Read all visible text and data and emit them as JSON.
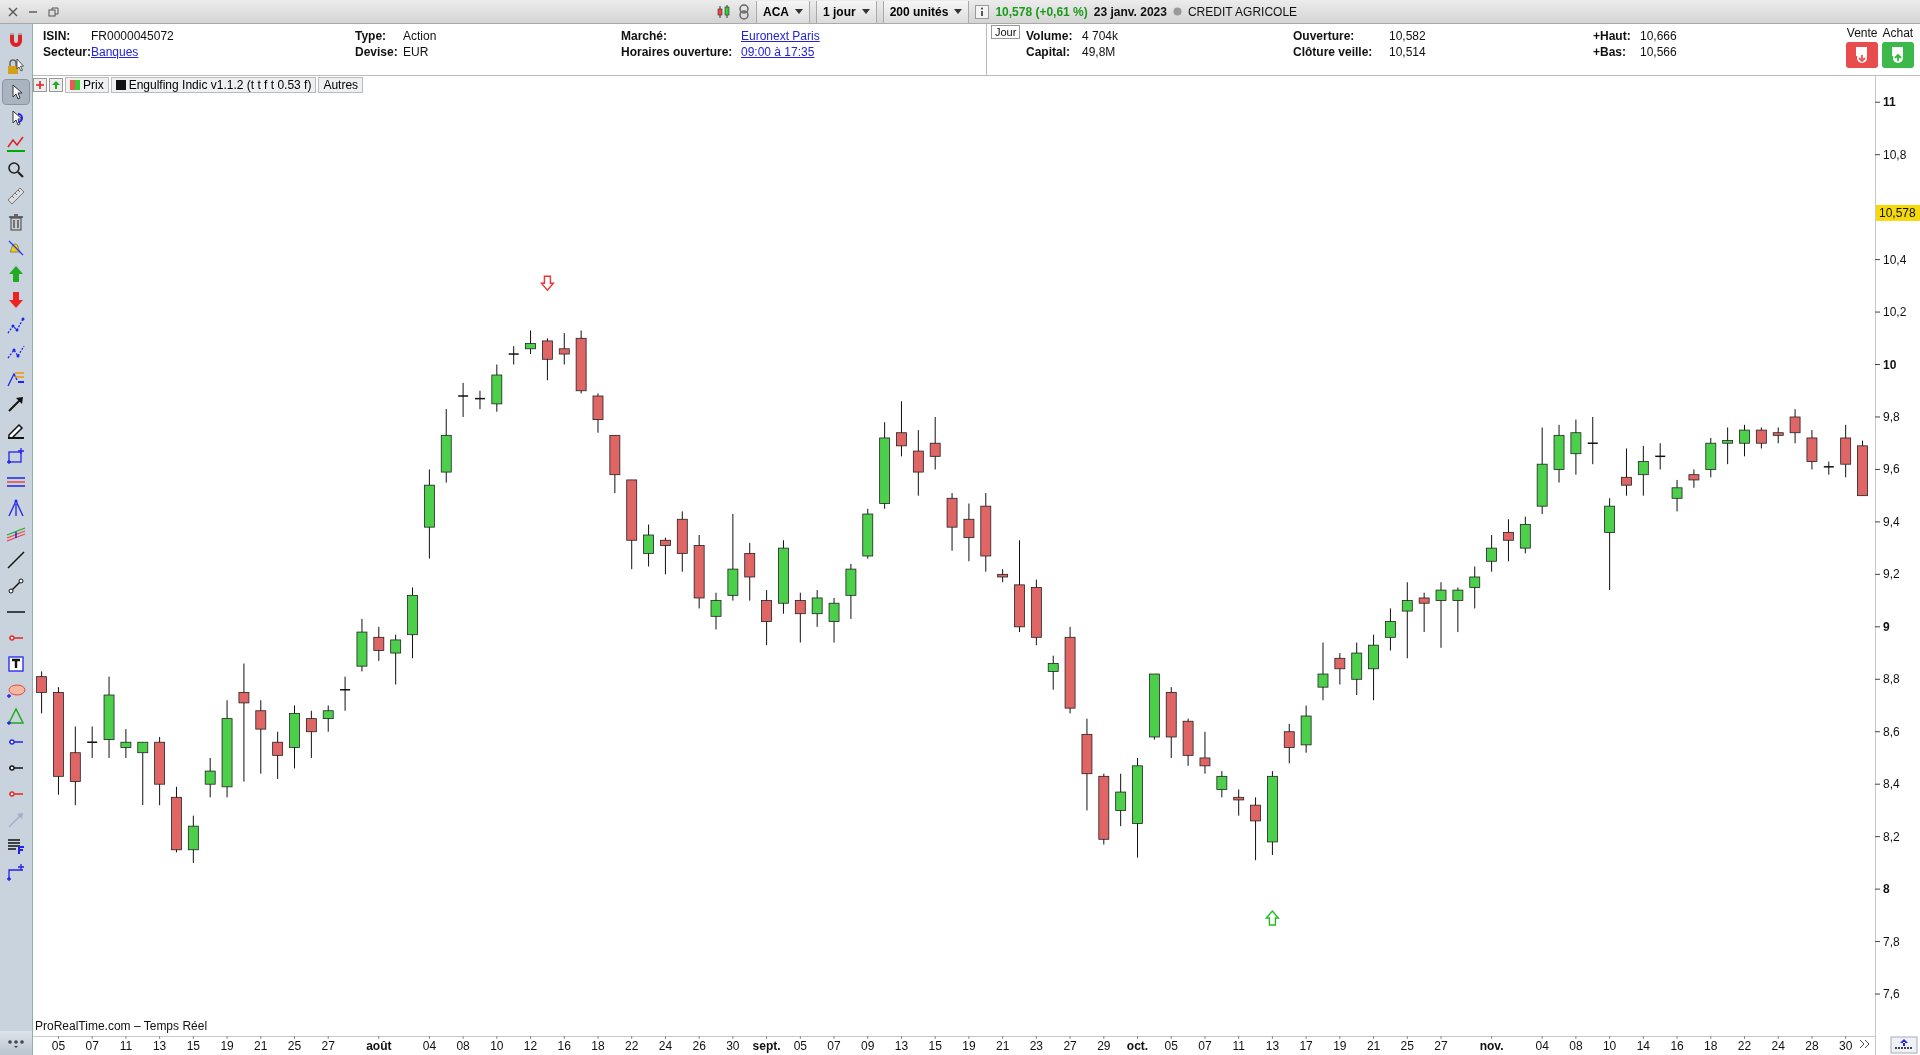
{
  "toolbar": {
    "symbol": "ACA",
    "period": "1 jour",
    "units": "200 unités",
    "quote": "10,578 (+0,61 %)",
    "date": "23 janv. 2023",
    "name": "CREDIT AGRICOLE"
  },
  "info": {
    "left": [
      {
        "label": "ISIN:",
        "value": "FR0000045072",
        "kind": "text"
      },
      {
        "label": "Type:",
        "value": "Action",
        "kind": "text"
      },
      {
        "label": "Marché:",
        "value": "Euronext Paris",
        "kind": "link"
      },
      {
        "label": "Secteur:",
        "value": "Banques",
        "kind": "link"
      },
      {
        "label": "Devise:",
        "value": "EUR",
        "kind": "text"
      },
      {
        "label": "Horaires ouverture:",
        "value": "09:00 à 17:35",
        "kind": "link"
      }
    ],
    "period_tab": "Jour",
    "right": [
      {
        "label": "Volume:",
        "value": "4 704k"
      },
      {
        "label": "Ouverture:",
        "value": "10,582"
      },
      {
        "label": "+Haut:",
        "value": "10,666"
      },
      {
        "label": "Capital:",
        "value": "49,8M"
      },
      {
        "label": "Clôture veille:",
        "value": "10,514"
      },
      {
        "label": "+Bas:",
        "value": "10,566"
      }
    ],
    "trade": {
      "sell_label": "Vente",
      "buy_label": "Achat"
    }
  },
  "tools": [
    {
      "selected": false
    },
    {
      "selected": false
    },
    {
      "selected": true
    },
    {
      "selected": false
    },
    {
      "selected": false
    },
    {
      "selected": false
    },
    {
      "selected": false
    },
    {
      "selected": false
    },
    {
      "selected": false
    },
    {
      "selected": false
    },
    {
      "selected": false
    },
    {
      "selected": false
    },
    {
      "selected": false
    },
    {
      "selected": false
    },
    {
      "selected": false
    },
    {
      "selected": false
    },
    {
      "selected": false
    },
    {
      "selected": false
    },
    {
      "selected": false
    },
    {
      "selected": false
    },
    {
      "selected": false
    },
    {
      "selected": false
    },
    {
      "selected": false
    },
    {
      "selected": false
    },
    {
      "selected": false
    },
    {
      "selected": false
    },
    {
      "selected": false
    },
    {
      "selected": false
    },
    {
      "selected": false
    },
    {
      "selected": false
    },
    {
      "selected": false
    },
    {
      "selected": false
    },
    {
      "selected": false
    }
  ],
  "legend": [
    {
      "label": "Prix",
      "kind": "price"
    },
    {
      "label": "Engulfing Indic v1.1.2 (t t f t 0.53 f)",
      "kind": "indicator"
    },
    {
      "label": "Autres",
      "kind": "plain"
    }
  ],
  "chart": {
    "source": "ProRealTime.com – Temps Réel",
    "price_tag": "10,578",
    "chart_data": {
      "type": "candlestick",
      "ylim": [
        7.44,
        11.1
      ],
      "categories": [
        null,
        "05",
        null,
        "07",
        null,
        "11",
        null,
        "13",
        null,
        "15",
        null,
        "19",
        null,
        "21",
        null,
        "25",
        null,
        "27",
        null,
        null,
        "août",
        null,
        null,
        "04",
        null,
        "08",
        null,
        "10",
        null,
        "12",
        null,
        "16",
        null,
        "18",
        null,
        "22",
        null,
        "24",
        null,
        "26",
        null,
        "30",
        null,
        "sept.",
        null,
        "05",
        null,
        "07",
        null,
        "09",
        null,
        "13",
        null,
        "15",
        null,
        "19",
        null,
        "21",
        null,
        "23",
        null,
        "27",
        null,
        "29",
        null,
        "oct.",
        null,
        "05",
        null,
        "07",
        null,
        "11",
        null,
        "13",
        null,
        "17",
        null,
        "19",
        null,
        "21",
        null,
        "25",
        null,
        "27",
        null,
        null,
        "nov.",
        null,
        null,
        "04",
        null,
        "08",
        null,
        "10",
        null,
        "14",
        null,
        "16",
        null,
        "18",
        null,
        "22",
        null,
        "24",
        null,
        "28",
        null,
        "30",
        null
      ],
      "ohlc": [
        [
          8.81,
          8.83,
          8.67,
          8.75
        ],
        [
          8.75,
          8.77,
          8.36,
          8.43
        ],
        [
          8.52,
          8.62,
          8.32,
          8.41
        ],
        [
          8.56,
          8.62,
          8.5,
          8.56
        ],
        [
          8.57,
          8.81,
          8.5,
          8.74
        ],
        [
          8.54,
          8.61,
          8.5,
          8.56
        ],
        [
          8.52,
          8.56,
          8.32,
          8.56
        ],
        [
          8.56,
          8.58,
          8.32,
          8.4
        ],
        [
          8.35,
          8.39,
          8.14,
          8.15
        ],
        [
          8.15,
          8.28,
          8.1,
          8.24
        ],
        [
          8.4,
          8.5,
          8.35,
          8.45
        ],
        [
          8.39,
          8.72,
          8.35,
          8.65
        ],
        [
          8.75,
          8.86,
          8.41,
          8.71
        ],
        [
          8.68,
          8.72,
          8.44,
          8.61
        ],
        [
          8.56,
          8.6,
          8.42,
          8.51
        ],
        [
          8.54,
          8.7,
          8.46,
          8.67
        ],
        [
          8.65,
          8.68,
          8.5,
          8.6
        ],
        [
          8.65,
          8.7,
          8.6,
          8.68
        ],
        [
          8.76,
          8.81,
          8.68,
          8.76
        ],
        [
          8.85,
          9.03,
          8.83,
          8.98
        ],
        [
          8.96,
          9.0,
          8.87,
          8.91
        ],
        [
          8.9,
          8.97,
          8.78,
          8.95
        ],
        [
          8.97,
          9.15,
          8.88,
          9.12
        ],
        [
          9.38,
          9.6,
          9.26,
          9.54
        ],
        [
          9.59,
          9.83,
          9.55,
          9.73
        ],
        [
          9.88,
          9.93,
          9.8,
          9.88
        ],
        [
          9.87,
          9.9,
          9.83,
          9.87
        ],
        [
          9.85,
          10.0,
          9.82,
          9.96
        ],
        [
          10.04,
          10.07,
          10.0,
          10.04
        ],
        [
          10.06,
          10.13,
          10.04,
          10.08
        ],
        [
          10.09,
          10.1,
          9.94,
          10.02
        ],
        [
          10.06,
          10.12,
          10.0,
          10.04
        ],
        [
          10.1,
          10.13,
          9.89,
          9.9
        ],
        [
          9.88,
          9.89,
          9.74,
          9.79
        ],
        [
          9.73,
          9.73,
          9.51,
          9.58
        ],
        [
          9.56,
          9.56,
          9.22,
          9.33
        ],
        [
          9.28,
          9.39,
          9.23,
          9.35
        ],
        [
          9.33,
          9.34,
          9.2,
          9.31
        ],
        [
          9.41,
          9.44,
          9.21,
          9.28
        ],
        [
          9.31,
          9.35,
          9.07,
          9.11
        ],
        [
          9.04,
          9.13,
          8.99,
          9.1
        ],
        [
          9.12,
          9.43,
          9.1,
          9.22
        ],
        [
          9.28,
          9.32,
          9.1,
          9.19
        ],
        [
          9.1,
          9.14,
          8.93,
          9.02
        ],
        [
          9.09,
          9.33,
          9.05,
          9.3
        ],
        [
          9.1,
          9.13,
          8.94,
          9.05
        ],
        [
          9.05,
          9.14,
          9.0,
          9.11
        ],
        [
          9.02,
          9.11,
          8.94,
          9.09
        ],
        [
          9.12,
          9.24,
          9.03,
          9.22
        ],
        [
          9.27,
          9.45,
          9.26,
          9.43
        ],
        [
          9.47,
          9.78,
          9.45,
          9.72
        ],
        [
          9.74,
          9.86,
          9.65,
          9.69
        ],
        [
          9.67,
          9.75,
          9.5,
          9.59
        ],
        [
          9.7,
          9.8,
          9.6,
          9.65
        ],
        [
          9.49,
          9.51,
          9.29,
          9.38
        ],
        [
          9.41,
          9.47,
          9.25,
          9.34
        ],
        [
          9.46,
          9.51,
          9.21,
          9.27
        ],
        [
          9.2,
          9.22,
          9.17,
          9.19
        ],
        [
          9.16,
          9.33,
          8.98,
          9.0
        ],
        [
          9.15,
          9.18,
          8.93,
          8.96
        ],
        [
          8.83,
          8.89,
          8.76,
          8.86
        ],
        [
          8.96,
          9.0,
          8.67,
          8.69
        ],
        [
          8.59,
          8.65,
          8.3,
          8.44
        ],
        [
          8.43,
          8.44,
          8.17,
          8.19
        ],
        [
          8.3,
          8.44,
          8.24,
          8.37
        ],
        [
          8.25,
          8.5,
          8.12,
          8.47
        ],
        [
          8.58,
          8.82,
          8.57,
          8.82
        ],
        [
          8.75,
          8.77,
          8.5,
          8.58
        ],
        [
          8.64,
          8.65,
          8.47,
          8.51
        ],
        [
          8.5,
          8.6,
          8.44,
          8.47
        ],
        [
          8.38,
          8.45,
          8.35,
          8.43
        ],
        [
          8.35,
          8.38,
          8.28,
          8.34
        ],
        [
          8.32,
          8.35,
          8.11,
          8.26
        ],
        [
          8.18,
          8.45,
          8.13,
          8.43
        ],
        [
          8.6,
          8.63,
          8.48,
          8.54
        ],
        [
          8.55,
          8.7,
          8.52,
          8.66
        ],
        [
          8.77,
          8.94,
          8.72,
          8.82
        ],
        [
          8.88,
          8.9,
          8.78,
          8.84
        ],
        [
          8.8,
          8.94,
          8.74,
          8.9
        ],
        [
          8.84,
          8.97,
          8.72,
          8.93
        ],
        [
          8.96,
          9.07,
          8.91,
          9.02
        ],
        [
          9.06,
          9.17,
          8.88,
          9.1
        ],
        [
          9.11,
          9.13,
          8.98,
          9.09
        ],
        [
          9.1,
          9.17,
          8.92,
          9.14
        ],
        [
          9.1,
          9.15,
          8.98,
          9.14
        ],
        [
          9.15,
          9.23,
          9.07,
          9.19
        ],
        [
          9.25,
          9.35,
          9.21,
          9.3
        ],
        [
          9.36,
          9.41,
          9.25,
          9.33
        ],
        [
          9.3,
          9.42,
          9.28,
          9.39
        ],
        [
          9.46,
          9.76,
          9.43,
          9.62
        ],
        [
          9.6,
          9.77,
          9.55,
          9.73
        ],
        [
          9.66,
          9.79,
          9.58,
          9.74
        ],
        [
          9.7,
          9.8,
          9.62,
          9.7
        ],
        [
          9.36,
          9.49,
          9.14,
          9.46
        ],
        [
          9.57,
          9.68,
          9.5,
          9.54
        ],
        [
          9.58,
          9.69,
          9.5,
          9.63
        ],
        [
          9.65,
          9.7,
          9.6,
          9.65
        ],
        [
          9.49,
          9.56,
          9.44,
          9.53
        ],
        [
          9.58,
          9.6,
          9.53,
          9.56
        ],
        [
          9.6,
          9.72,
          9.57,
          9.7
        ],
        [
          9.7,
          9.76,
          9.62,
          9.71
        ],
        [
          9.7,
          9.77,
          9.65,
          9.75
        ],
        [
          9.75,
          9.76,
          9.68,
          9.7
        ],
        [
          9.74,
          9.76,
          9.7,
          9.73
        ],
        [
          9.8,
          9.83,
          9.7,
          9.74
        ],
        [
          9.72,
          9.75,
          9.6,
          9.63
        ],
        [
          9.61,
          9.63,
          9.58,
          9.61
        ],
        [
          9.72,
          9.77,
          9.57,
          9.62
        ],
        [
          9.69,
          9.71,
          9.5,
          9.5
        ]
      ],
      "yticks": [
        {
          "value": 7.6,
          "label": "7,6"
        },
        {
          "value": 7.8,
          "label": "7,8"
        },
        {
          "value": 8,
          "label": "8"
        },
        {
          "value": 8.2,
          "label": "8,2"
        },
        {
          "value": 8.4,
          "label": "8,4"
        },
        {
          "value": 8.6,
          "label": "8,6"
        },
        {
          "value": 8.8,
          "label": "8,8"
        },
        {
          "value": 9,
          "label": "9"
        },
        {
          "value": 9.2,
          "label": "9,2"
        },
        {
          "value": 9.4,
          "label": "9,4"
        },
        {
          "value": 9.6,
          "label": "9,6"
        },
        {
          "value": 9.8,
          "label": "9,8"
        },
        {
          "value": 10,
          "label": "10"
        },
        {
          "value": 10.2,
          "label": "10,2"
        },
        {
          "value": 10.4,
          "label": "10,4"
        },
        {
          "value": 10.8,
          "label": "10,8"
        },
        {
          "value": 11,
          "label": "11"
        }
      ]
    }
  }
}
